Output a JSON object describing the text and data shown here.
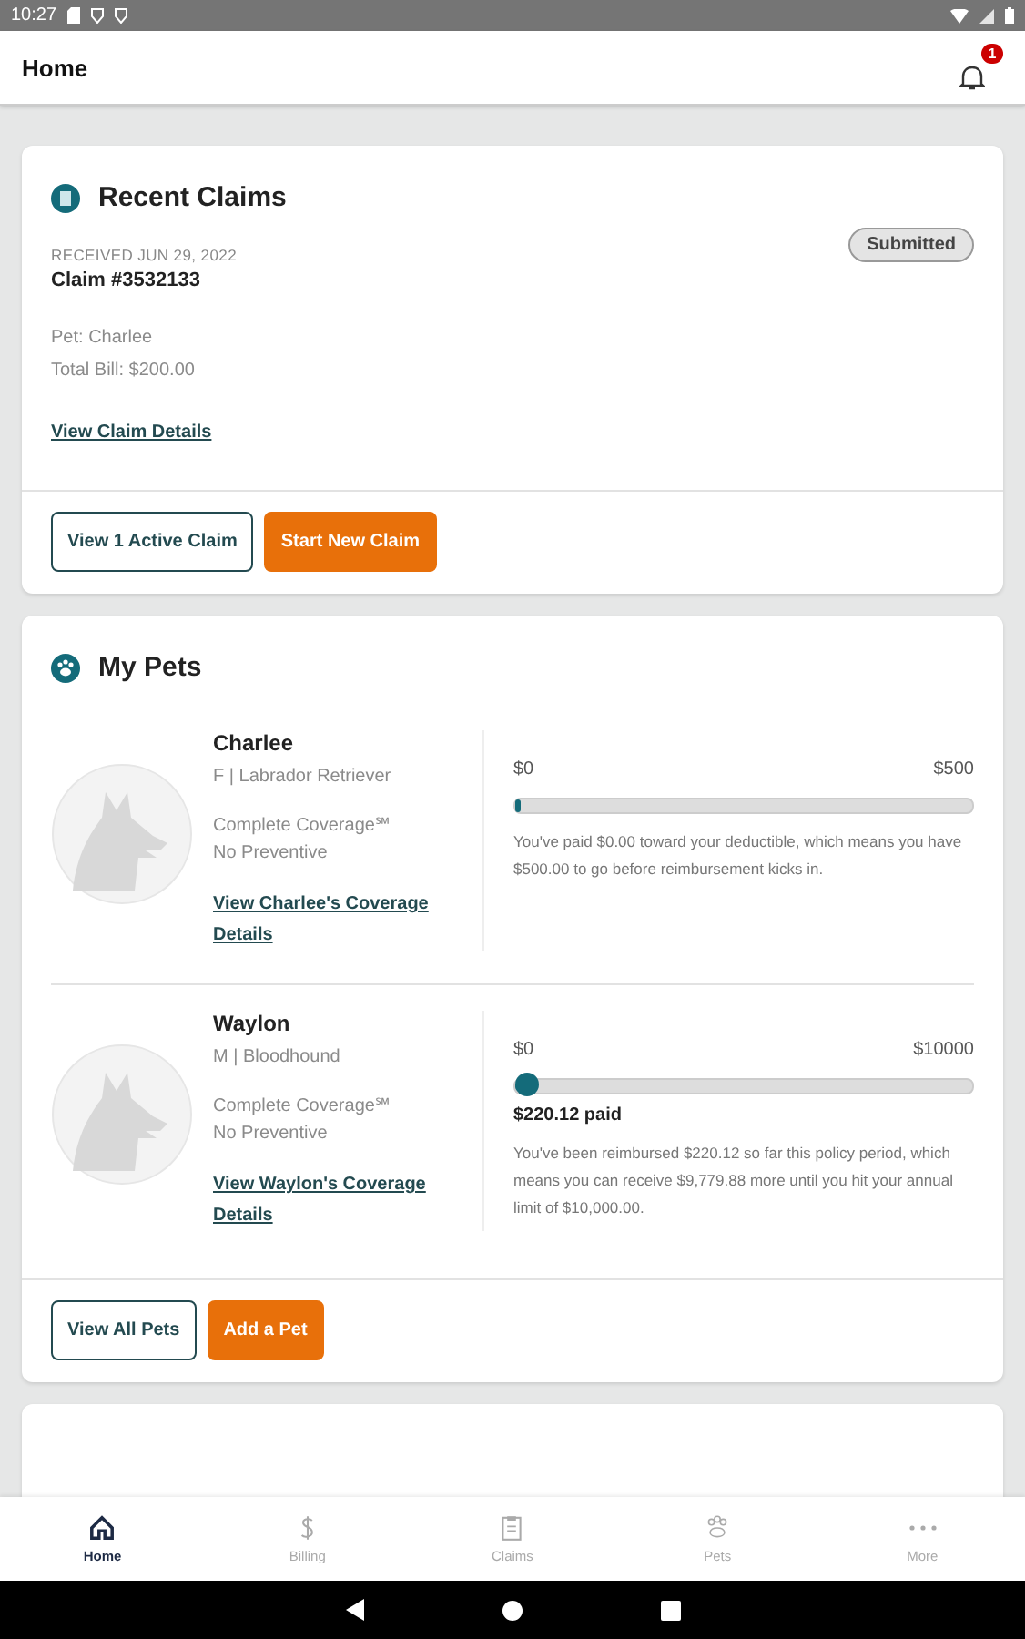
{
  "status_bar": {
    "time": "10:27"
  },
  "app_bar": {
    "title": "Home",
    "notification_count": "1"
  },
  "recent_claims": {
    "title": "Recent Claims",
    "received": "RECEIVED JUN 29, 2022",
    "claim": "Claim #3532133",
    "status": "Submitted",
    "pet": "Pet: Charlee",
    "total": "Total Bill: $200.00",
    "link": "View Claim Details",
    "buttons": [
      {
        "label": "View 1 Active Claim",
        "kind": "outline"
      },
      {
        "label": "Start New Claim",
        "kind": "primary"
      }
    ]
  },
  "my_pets": {
    "title": "My Pets",
    "pets": [
      {
        "name": "Charlee",
        "details": "F | Labrador Retriever",
        "plan": "Complete Coverage℠",
        "preventive": "No Preventive",
        "link": "View Charlee's Coverage Details",
        "min": "$0",
        "max": "$500",
        "level": 0,
        "note": "You've paid $0.00 toward your deductible, which means you have $500.00 to go before reimbursement kicks in."
      },
      {
        "name": "Waylon",
        "details": "M | Bloodhound",
        "plan": "Complete Coverage℠",
        "preventive": "No Preventive",
        "link": "View Waylon's Coverage Details",
        "min": "$0",
        "max": "$10000",
        "level": 0.022,
        "paid": "$220.12 paid",
        "note": "You've been reimbursed $220.12 so far this policy period, which means you can receive $9,779.88 more until you hit your annual limit of $10,000.00."
      }
    ],
    "buttons": [
      {
        "label": "View All Pets",
        "kind": "outline"
      },
      {
        "label": "Add a Pet",
        "kind": "primary"
      }
    ]
  },
  "bottom_nav": [
    {
      "label": "Home",
      "selected": true
    },
    {
      "label": "Billing",
      "selected": false
    },
    {
      "label": "Claims",
      "selected": false
    },
    {
      "label": "Pets",
      "selected": false
    },
    {
      "label": "More",
      "selected": false
    }
  ]
}
